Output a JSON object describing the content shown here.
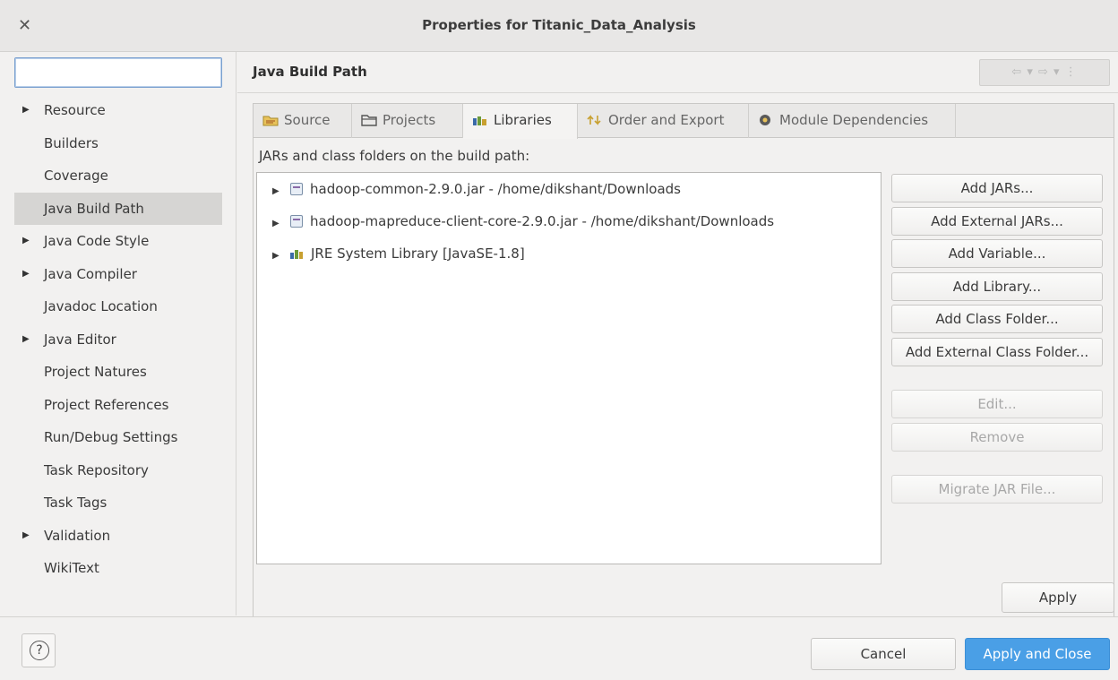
{
  "window": {
    "title": "Properties for Titanic_Data_Analysis"
  },
  "filter": {
    "placeholder": "",
    "value": ""
  },
  "sidebar": {
    "items": [
      {
        "label": "Resource",
        "expandable": true
      },
      {
        "label": "Builders",
        "expandable": false
      },
      {
        "label": "Coverage",
        "expandable": false
      },
      {
        "label": "Java Build Path",
        "expandable": false,
        "selected": true
      },
      {
        "label": "Java Code Style",
        "expandable": true
      },
      {
        "label": "Java Compiler",
        "expandable": true
      },
      {
        "label": "Javadoc Location",
        "expandable": false
      },
      {
        "label": "Java Editor",
        "expandable": true
      },
      {
        "label": "Project Natures",
        "expandable": false
      },
      {
        "label": "Project References",
        "expandable": false
      },
      {
        "label": "Run/Debug Settings",
        "expandable": false
      },
      {
        "label": "Task Repository",
        "expandable": false
      },
      {
        "label": "Task Tags",
        "expandable": false
      },
      {
        "label": "Validation",
        "expandable": true
      },
      {
        "label": "WikiText",
        "expandable": false
      }
    ]
  },
  "page": {
    "title": "Java Build Path"
  },
  "tabs": [
    {
      "label": "Source",
      "icon": "source-folder-icon"
    },
    {
      "label": "Projects",
      "icon": "projects-icon"
    },
    {
      "label": "Libraries",
      "icon": "libraries-icon",
      "active": true
    },
    {
      "label": "Order and Export",
      "icon": "order-export-icon"
    },
    {
      "label": "Module Dependencies",
      "icon": "module-icon"
    }
  ],
  "libraries": {
    "heading": "JARs and class folders on the build path:",
    "entries": [
      {
        "label": "hadoop-common-2.9.0.jar - /home/dikshant/Downloads",
        "icon": "jar-icon"
      },
      {
        "label": "hadoop-mapreduce-client-core-2.9.0.jar - /home/dikshant/Downloads",
        "icon": "jar-icon"
      },
      {
        "label": "JRE System Library [JavaSE-1.8]",
        "icon": "library-icon"
      }
    ]
  },
  "buttons": {
    "add_jars": "Add JARs...",
    "add_external_jars": "Add External JARs...",
    "add_variable": "Add Variable...",
    "add_library": "Add Library...",
    "add_class_folder": "Add Class Folder...",
    "add_external_class_folder": "Add External Class Folder...",
    "edit": "Edit...",
    "remove": "Remove",
    "migrate_jar": "Migrate JAR File...",
    "apply": "Apply"
  },
  "footer": {
    "help": "?",
    "cancel": "Cancel",
    "apply_and_close": "Apply and Close"
  },
  "colors": {
    "accent": "#4a9fe6",
    "selection": "#d6d5d3"
  }
}
